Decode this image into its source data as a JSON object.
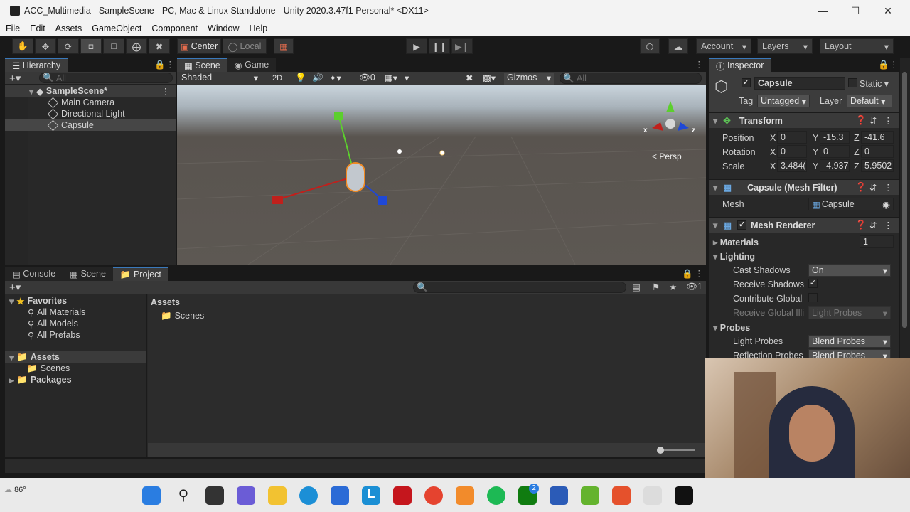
{
  "window": {
    "title": "ACC_Multimedia - SampleScene - PC, Mac & Linux Standalone - Unity 2020.3.47f1 Personal* <DX11>"
  },
  "menu": [
    "File",
    "Edit",
    "Assets",
    "GameObject",
    "Component",
    "Window",
    "Help"
  ],
  "toolbar": {
    "center": "Center",
    "local": "Local",
    "account": "Account",
    "layers": "Layers",
    "layout": "Layout"
  },
  "hierarchy": {
    "tab": "Hierarchy",
    "search": "All",
    "scene": "SampleScene*",
    "items": [
      "Main Camera",
      "Directional Light",
      "Capsule"
    ]
  },
  "scene": {
    "tabs": [
      "Scene",
      "Game"
    ],
    "shading": "Shaded",
    "mode2d": "2D",
    "fx_count": "0",
    "gizmos": "Gizmos",
    "search": "All",
    "persp": "Persp",
    "axis_x": "x",
    "axis_z": "z"
  },
  "project": {
    "tabs": [
      "Console",
      "Scene",
      "Project"
    ],
    "favorites": "Favorites",
    "fav_items": [
      "All Materials",
      "All Models",
      "All Prefabs"
    ],
    "assets": "Assets",
    "scenes": "Scenes",
    "packages": "Packages",
    "breadcrumb": "Assets",
    "folder": "Scenes",
    "hidden_count": "1"
  },
  "inspector": {
    "tab": "Inspector",
    "name": "Capsule",
    "static": "Static",
    "tag_label": "Tag",
    "tag": "Untagged",
    "layer_label": "Layer",
    "layer": "Default",
    "transform": "Transform",
    "position_label": "Position",
    "rotation_label": "Rotation",
    "scale_label": "Scale",
    "pos": {
      "x": "0",
      "y": "-15.3",
      "z": "-41.6"
    },
    "rot": {
      "x": "0",
      "y": "0",
      "z": "0"
    },
    "scale": {
      "x": "3.484(",
      "y": "-4.937",
      "z": "5.9502"
    },
    "mesh_filter": "Capsule (Mesh Filter)",
    "mesh_label": "Mesh",
    "mesh": "Capsule",
    "mesh_renderer": "Mesh Renderer",
    "materials": "Materials",
    "materials_count": "1",
    "lighting": "Lighting",
    "cast_shadows_label": "Cast Shadows",
    "cast_shadows": "On",
    "receive_shadows_label": "Receive Shadows",
    "contribute_gi_label": "Contribute Global",
    "receive_gi_label": "Receive Global Illi",
    "receive_gi": "Light Probes",
    "probes": "Probes",
    "light_probes_label": "Light Probes",
    "light_probes": "Blend Probes",
    "reflection_probes_label": "Reflection Probes",
    "reflection_probes": "Blend Probes"
  },
  "taskbar": {
    "weather": "86°",
    "xbox_badge": "2"
  },
  "colors": {
    "accent": "#3a79bb",
    "x_axis": "#c0201c",
    "y_axis": "#5ccf2d",
    "z_axis": "#1f48d6"
  }
}
